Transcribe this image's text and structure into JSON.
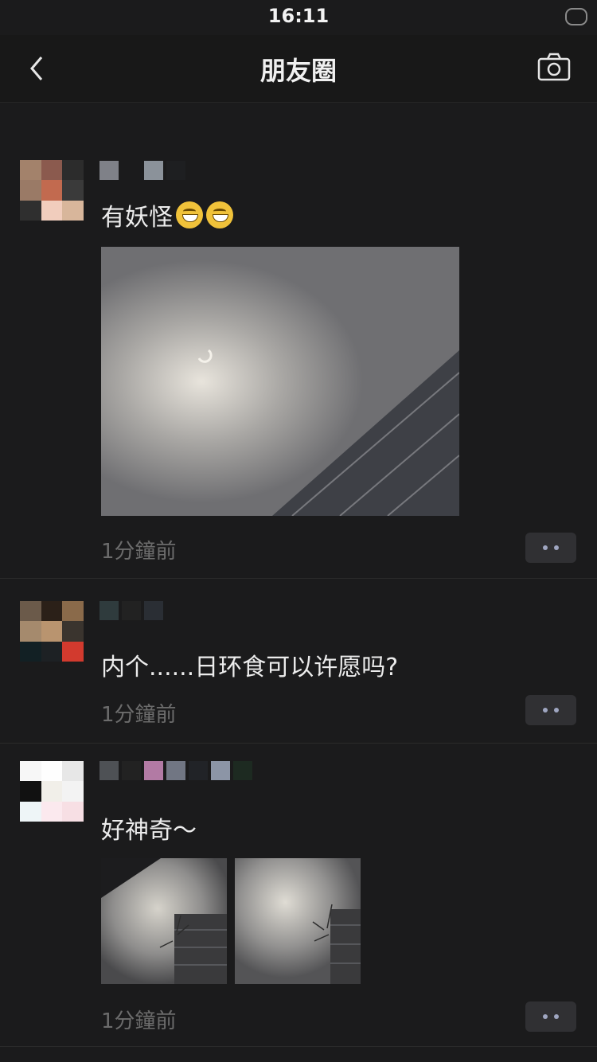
{
  "status_bar": {
    "time": "16:11"
  },
  "nav": {
    "title": "朋友圈",
    "back_icon": "chevron-left-icon",
    "camera_icon": "camera-icon"
  },
  "posts": [
    {
      "text": "有妖怪",
      "emoji": "grinning-emoji",
      "time": "1分鐘前",
      "images": 1
    },
    {
      "text": "内个......日环食可以许愿吗?",
      "time": "1分鐘前",
      "images": 0
    },
    {
      "text": "好神奇～",
      "time": "1分鐘前",
      "images": 2
    }
  ],
  "colors": {
    "background": "#1b1b1c",
    "text": "#ececec",
    "muted": "#6c6c6c",
    "more_dots": "#9fa6c1"
  }
}
